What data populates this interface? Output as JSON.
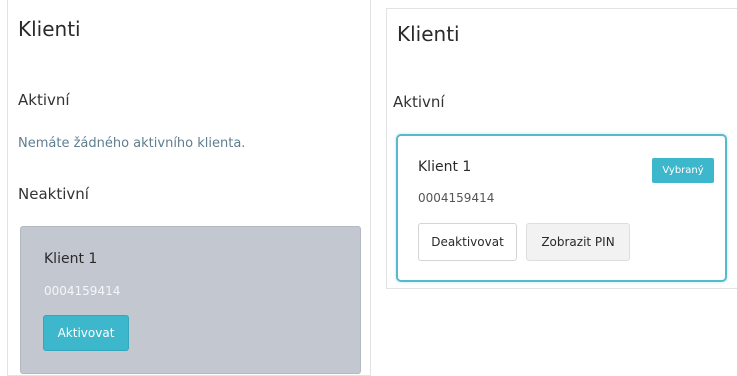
{
  "left": {
    "title": "Klienti",
    "active_heading": "Aktivní",
    "empty_message": "Nemáte žádného aktivního klienta.",
    "inactive_heading": "Neaktivní",
    "client": {
      "name": "Klient 1",
      "id": "0004159414",
      "activate_label": "Aktivovat"
    }
  },
  "right": {
    "title": "Klienti",
    "active_heading": "Aktivní",
    "client": {
      "name": "Klient 1",
      "id": "0004159414",
      "badge": "Vybraný",
      "deactivate_label": "Deaktivovat",
      "show_pin_label": "Zobrazit PIN"
    }
  },
  "colors": {
    "accent": "#3cb7cc",
    "inactive_card_bg": "#c3c7d0",
    "active_card_border": "#58b9cc"
  }
}
